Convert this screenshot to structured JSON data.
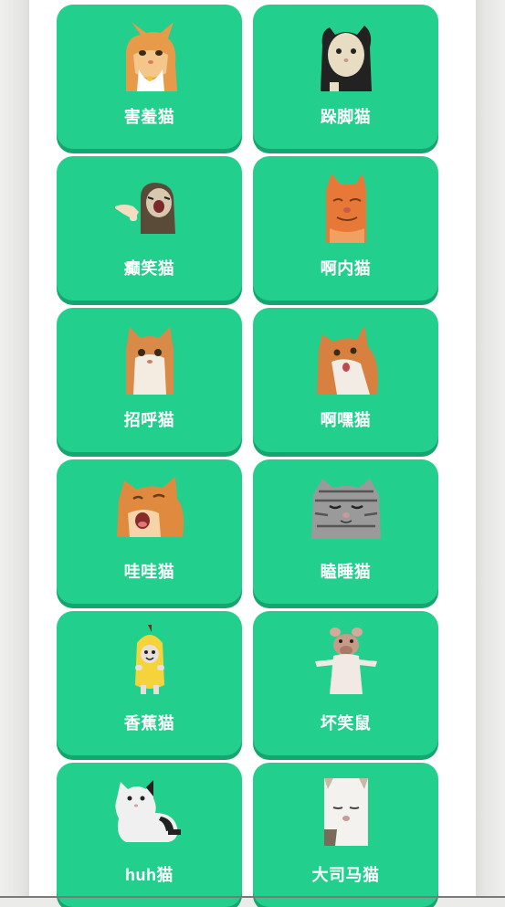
{
  "cards": [
    {
      "label": "害羞猫",
      "icon": "orange-cat-shy-icon"
    },
    {
      "label": "跺脚猫",
      "icon": "black-white-cat-stomp-icon"
    },
    {
      "label": "癫笑猫",
      "icon": "laughing-cat-icon"
    },
    {
      "label": "啊内猫",
      "icon": "orange-cat-squint-icon"
    },
    {
      "label": "招呼猫",
      "icon": "orange-white-cat-greeting-icon"
    },
    {
      "label": "啊嘿猫",
      "icon": "orange-cat-aheh-icon"
    },
    {
      "label": "哇哇猫",
      "icon": "orange-cat-crying-icon"
    },
    {
      "label": "瞌睡猫",
      "icon": "tabby-cat-sleepy-icon"
    },
    {
      "label": "香蕉猫",
      "icon": "banana-cat-icon"
    },
    {
      "label": "坏笑鼠",
      "icon": "smirking-rat-icon"
    },
    {
      "label": "huh猫",
      "icon": "white-cat-huh-icon"
    },
    {
      "label": "大司马猫",
      "icon": "white-cat-closeup-icon"
    }
  ]
}
